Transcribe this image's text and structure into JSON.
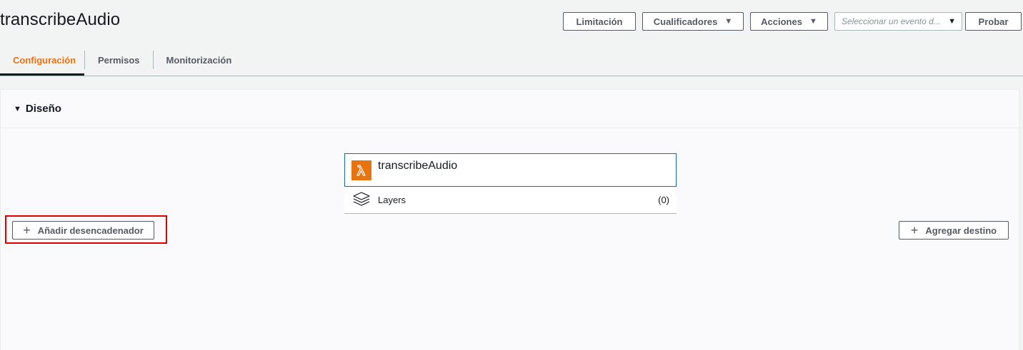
{
  "header": {
    "title": "transcribeAudio",
    "buttons": {
      "limitation": "Limitación",
      "qualifiers": "Cualificadores",
      "actions": "Acciones",
      "test": "Probar"
    },
    "event_select": {
      "placeholder": "Seleccionar un evento d..."
    }
  },
  "tabs": [
    {
      "label": "Configuración",
      "active": true
    },
    {
      "label": "Permisos",
      "active": false
    },
    {
      "label": "Monitorización",
      "active": false
    }
  ],
  "design": {
    "heading": "Diseño",
    "function_card": {
      "name": "transcribeAudio",
      "icon": "lambda-icon",
      "layers_label": "Layers",
      "layers_count": "(0)"
    },
    "add_trigger_label": "Añadir desencadenador",
    "add_destination_label": "Agregar destino"
  },
  "colors": {
    "accent": "#ec7211",
    "lambda_icon_bg": "#e8730f",
    "highlight": "#e00000"
  }
}
